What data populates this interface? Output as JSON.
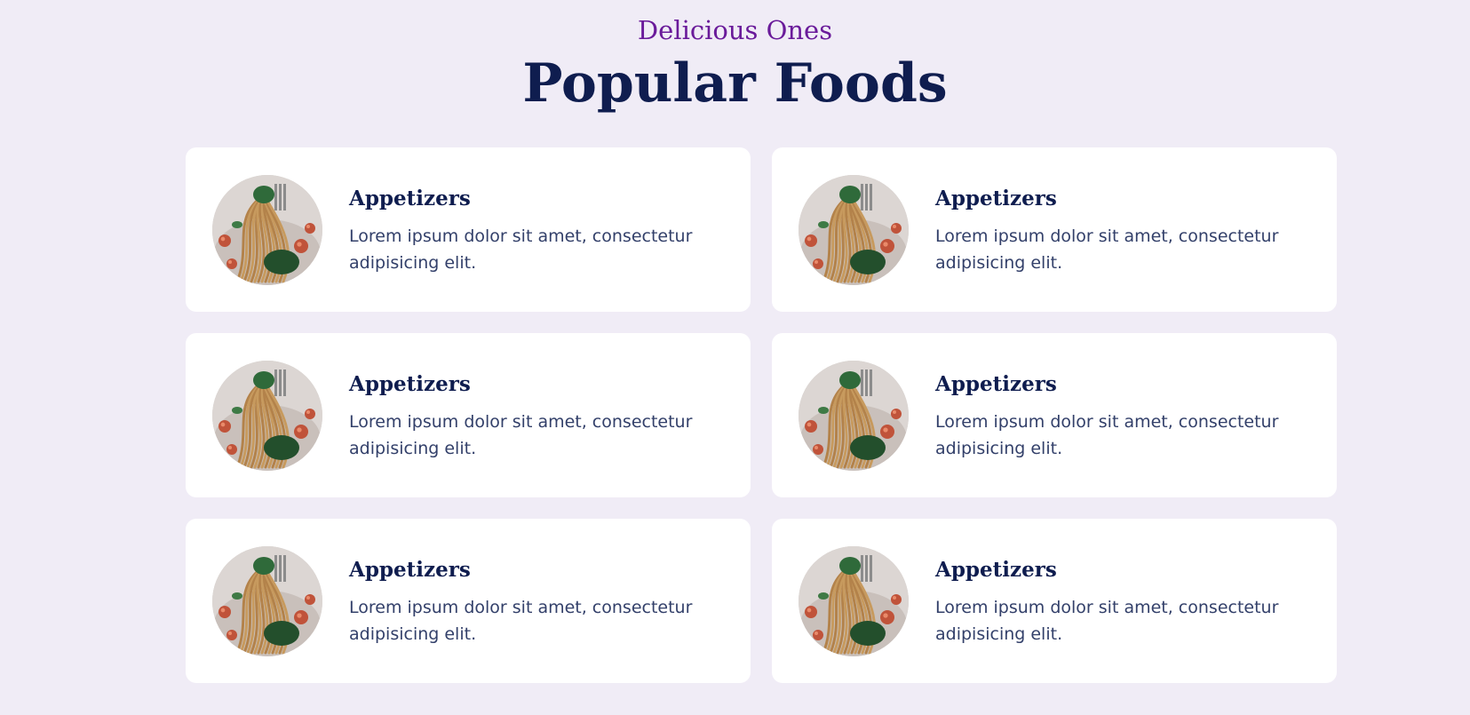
{
  "section": {
    "subtitle": "Delicious Ones",
    "title": "Popular Foods"
  },
  "cards": [
    {
      "title": "Appetizers",
      "text": "Lorem ipsum dolor sit amet, consectetur adipisicing elit.",
      "image": "pasta-dish-photo"
    },
    {
      "title": "Appetizers",
      "text": "Lorem ipsum dolor sit amet, consectetur adipisicing elit.",
      "image": "pasta-dish-photo"
    },
    {
      "title": "Appetizers",
      "text": "Lorem ipsum dolor sit amet, consectetur adipisicing elit.",
      "image": "pasta-dish-photo"
    },
    {
      "title": "Appetizers",
      "text": "Lorem ipsum dolor sit amet, consectetur adipisicing elit.",
      "image": "pasta-dish-photo"
    },
    {
      "title": "Appetizers",
      "text": "Lorem ipsum dolor sit amet, consectetur adipisicing elit.",
      "image": "pasta-dish-photo"
    },
    {
      "title": "Appetizers",
      "text": "Lorem ipsum dolor sit amet, consectetur adipisicing elit.",
      "image": "pasta-dish-photo"
    }
  ],
  "colors": {
    "background": "#f0ecf6",
    "subtitle": "#6a1b9a",
    "title": "#0f1d4f",
    "card": "#ffffff",
    "body_text": "#33406a"
  }
}
